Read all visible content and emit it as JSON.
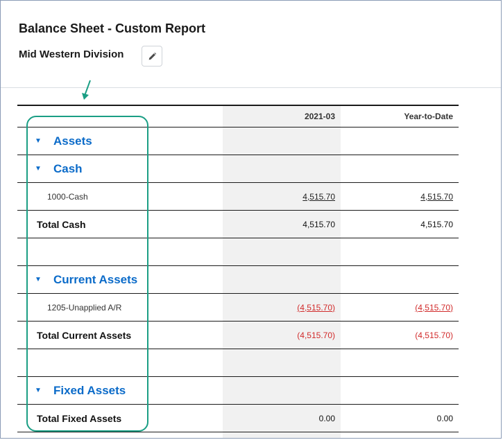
{
  "header": {
    "title": "Balance Sheet - Custom Report",
    "subtitle": "Mid Western Division",
    "edit_icon": "pencil-icon"
  },
  "columns": {
    "period": "2021-03",
    "ytd": "Year-to-Date"
  },
  "sections": {
    "assets": "Assets",
    "cash": "Cash",
    "current_assets": "Current Assets",
    "fixed_assets": "Fixed Assets"
  },
  "rows": {
    "cash_account": {
      "label": "1000-Cash",
      "period": "4,515.70",
      "ytd": "4,515.70"
    },
    "total_cash": {
      "label": "Total Cash",
      "period": "4,515.70",
      "ytd": "4,515.70"
    },
    "unapplied_ar": {
      "label": "1205-Unapplied A/R",
      "period": "(4,515.70)",
      "ytd": "(4,515.70)"
    },
    "total_current_assets": {
      "label": "Total Current Assets",
      "period": "(4,515.70)",
      "ytd": "(4,515.70)"
    },
    "total_fixed_assets": {
      "label": "Total Fixed Assets",
      "period": "0.00",
      "ytd": "0.00"
    }
  },
  "colors": {
    "section_blue": "#0b6bc9",
    "negative_red": "#d12b2b",
    "highlight_green": "#1a9e84"
  }
}
